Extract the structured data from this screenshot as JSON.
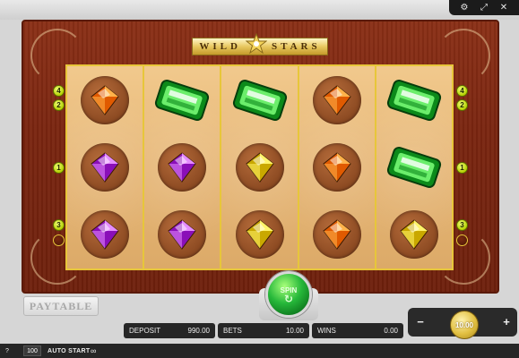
{
  "game": {
    "title_left": "WILD",
    "title_right": "STARS"
  },
  "top_controls": {
    "icons": [
      "gear-icon",
      "fullscreen-icon",
      "close-icon"
    ],
    "glyphs": [
      "⚙",
      "⤢",
      "✕"
    ]
  },
  "reels": [
    [
      "orange-diamond",
      "purple-diamond",
      "purple-diamond"
    ],
    [
      "emerald",
      "purple-diamond",
      "purple-diamond"
    ],
    [
      "emerald",
      "yellow-diamond",
      "yellow-diamond"
    ],
    [
      "orange-diamond",
      "orange-diamond",
      "orange-diamond"
    ],
    [
      "emerald",
      "emerald",
      "yellow-diamond"
    ]
  ],
  "gem_colors": {
    "orange-diamond": {
      "light": "#ffb24a",
      "dark": "#e05a00"
    },
    "purple-diamond": {
      "light": "#e58cff",
      "dark": "#8a0fb8"
    },
    "yellow-diamond": {
      "light": "#fff36a",
      "dark": "#c9a800"
    },
    "emerald": {
      "light": "#7dff7a",
      "dark": "#0c8a1a"
    }
  },
  "paylines": {
    "left": [
      "4",
      "2",
      "1",
      "3",
      ""
    ],
    "right": [
      "4",
      "2",
      "1",
      "3",
      ""
    ]
  },
  "buttons": {
    "paytable": "PAYTABLE",
    "spin": "SPIN",
    "stake_minus": "−",
    "stake_plus": "+"
  },
  "stake": "10.00",
  "info": {
    "deposit_label": "DEPOSIT",
    "deposit_value": "990.00",
    "bets_label": "BETS",
    "bets_value": "10.00",
    "wins_label": "WINS",
    "wins_value": "0.00"
  },
  "bottom": {
    "help_glyph": "?",
    "autostart_count": "100",
    "autostart_label": "AUTO START",
    "loop_glyph": "∞"
  }
}
